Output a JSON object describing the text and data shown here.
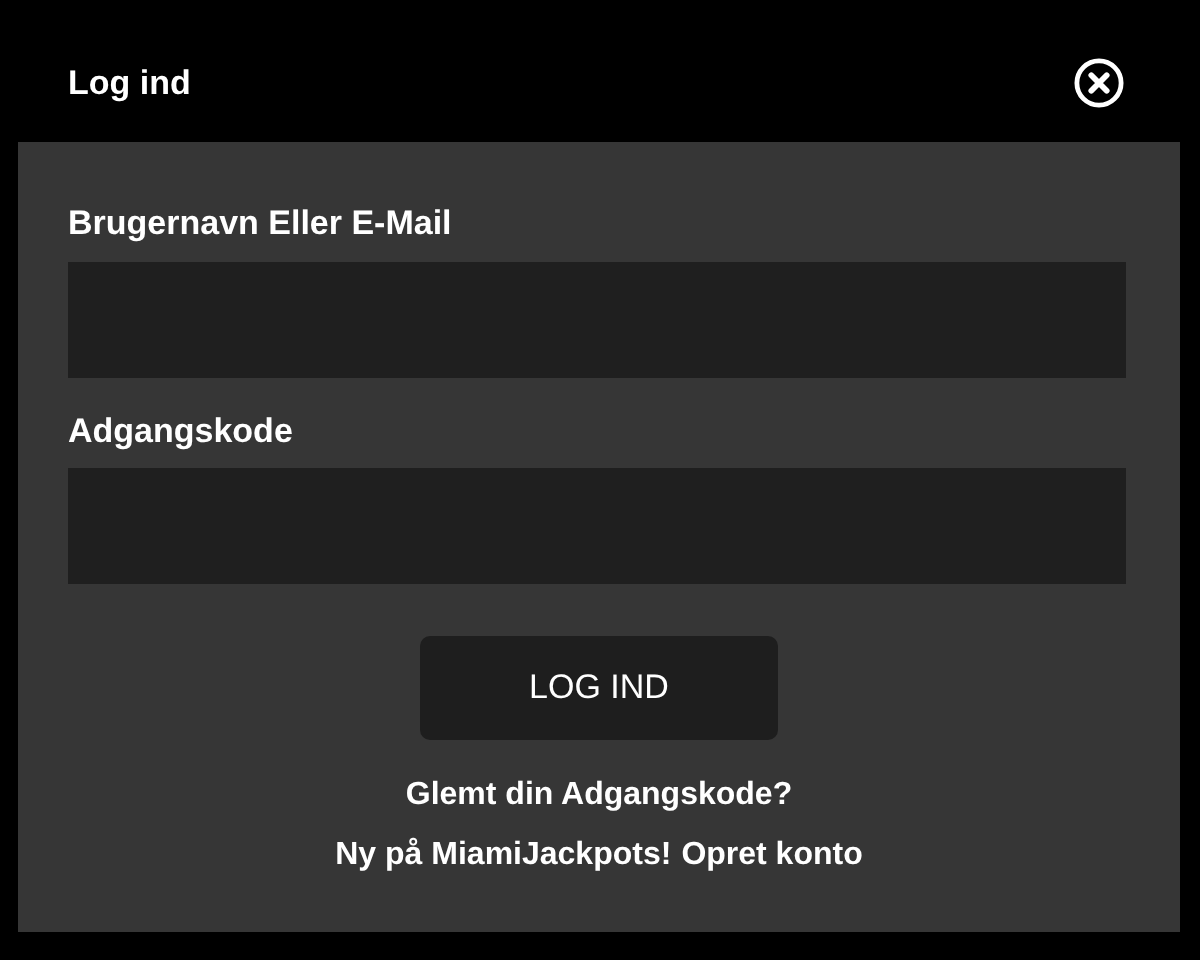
{
  "dialog": {
    "title": "Log ind"
  },
  "fields": [
    {
      "label": "Brugernavn Eller E-Mail"
    },
    {
      "label": "Adgangskode"
    }
  ],
  "submit": "LOG IND",
  "forgot_link": "Glemt din Adgangskode?",
  "signup_text": "Ny på MiamiJackpots!",
  "signup_link": "Opret konto"
}
